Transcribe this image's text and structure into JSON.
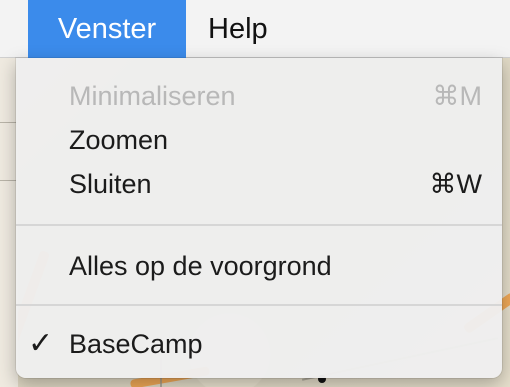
{
  "menubar": {
    "items": [
      {
        "label": "Venster"
      },
      {
        "label": "Help"
      }
    ]
  },
  "menu": {
    "items": [
      {
        "label": "Minimaliseren",
        "shortcut": "⌘M",
        "enabled": false
      },
      {
        "label": "Zoomen",
        "shortcut": "",
        "enabled": true
      },
      {
        "label": "Sluiten",
        "shortcut": "⌘W",
        "enabled": true
      },
      {
        "label": "Alles op de voorgrond",
        "shortcut": "",
        "enabled": true
      },
      {
        "label": "BaseCamp",
        "shortcut": "",
        "enabled": true,
        "checked": true
      }
    ],
    "check_glyph": "✓"
  },
  "colors": {
    "active_menu": "#3b8beb",
    "disabled_text": "#b8b8b8"
  }
}
